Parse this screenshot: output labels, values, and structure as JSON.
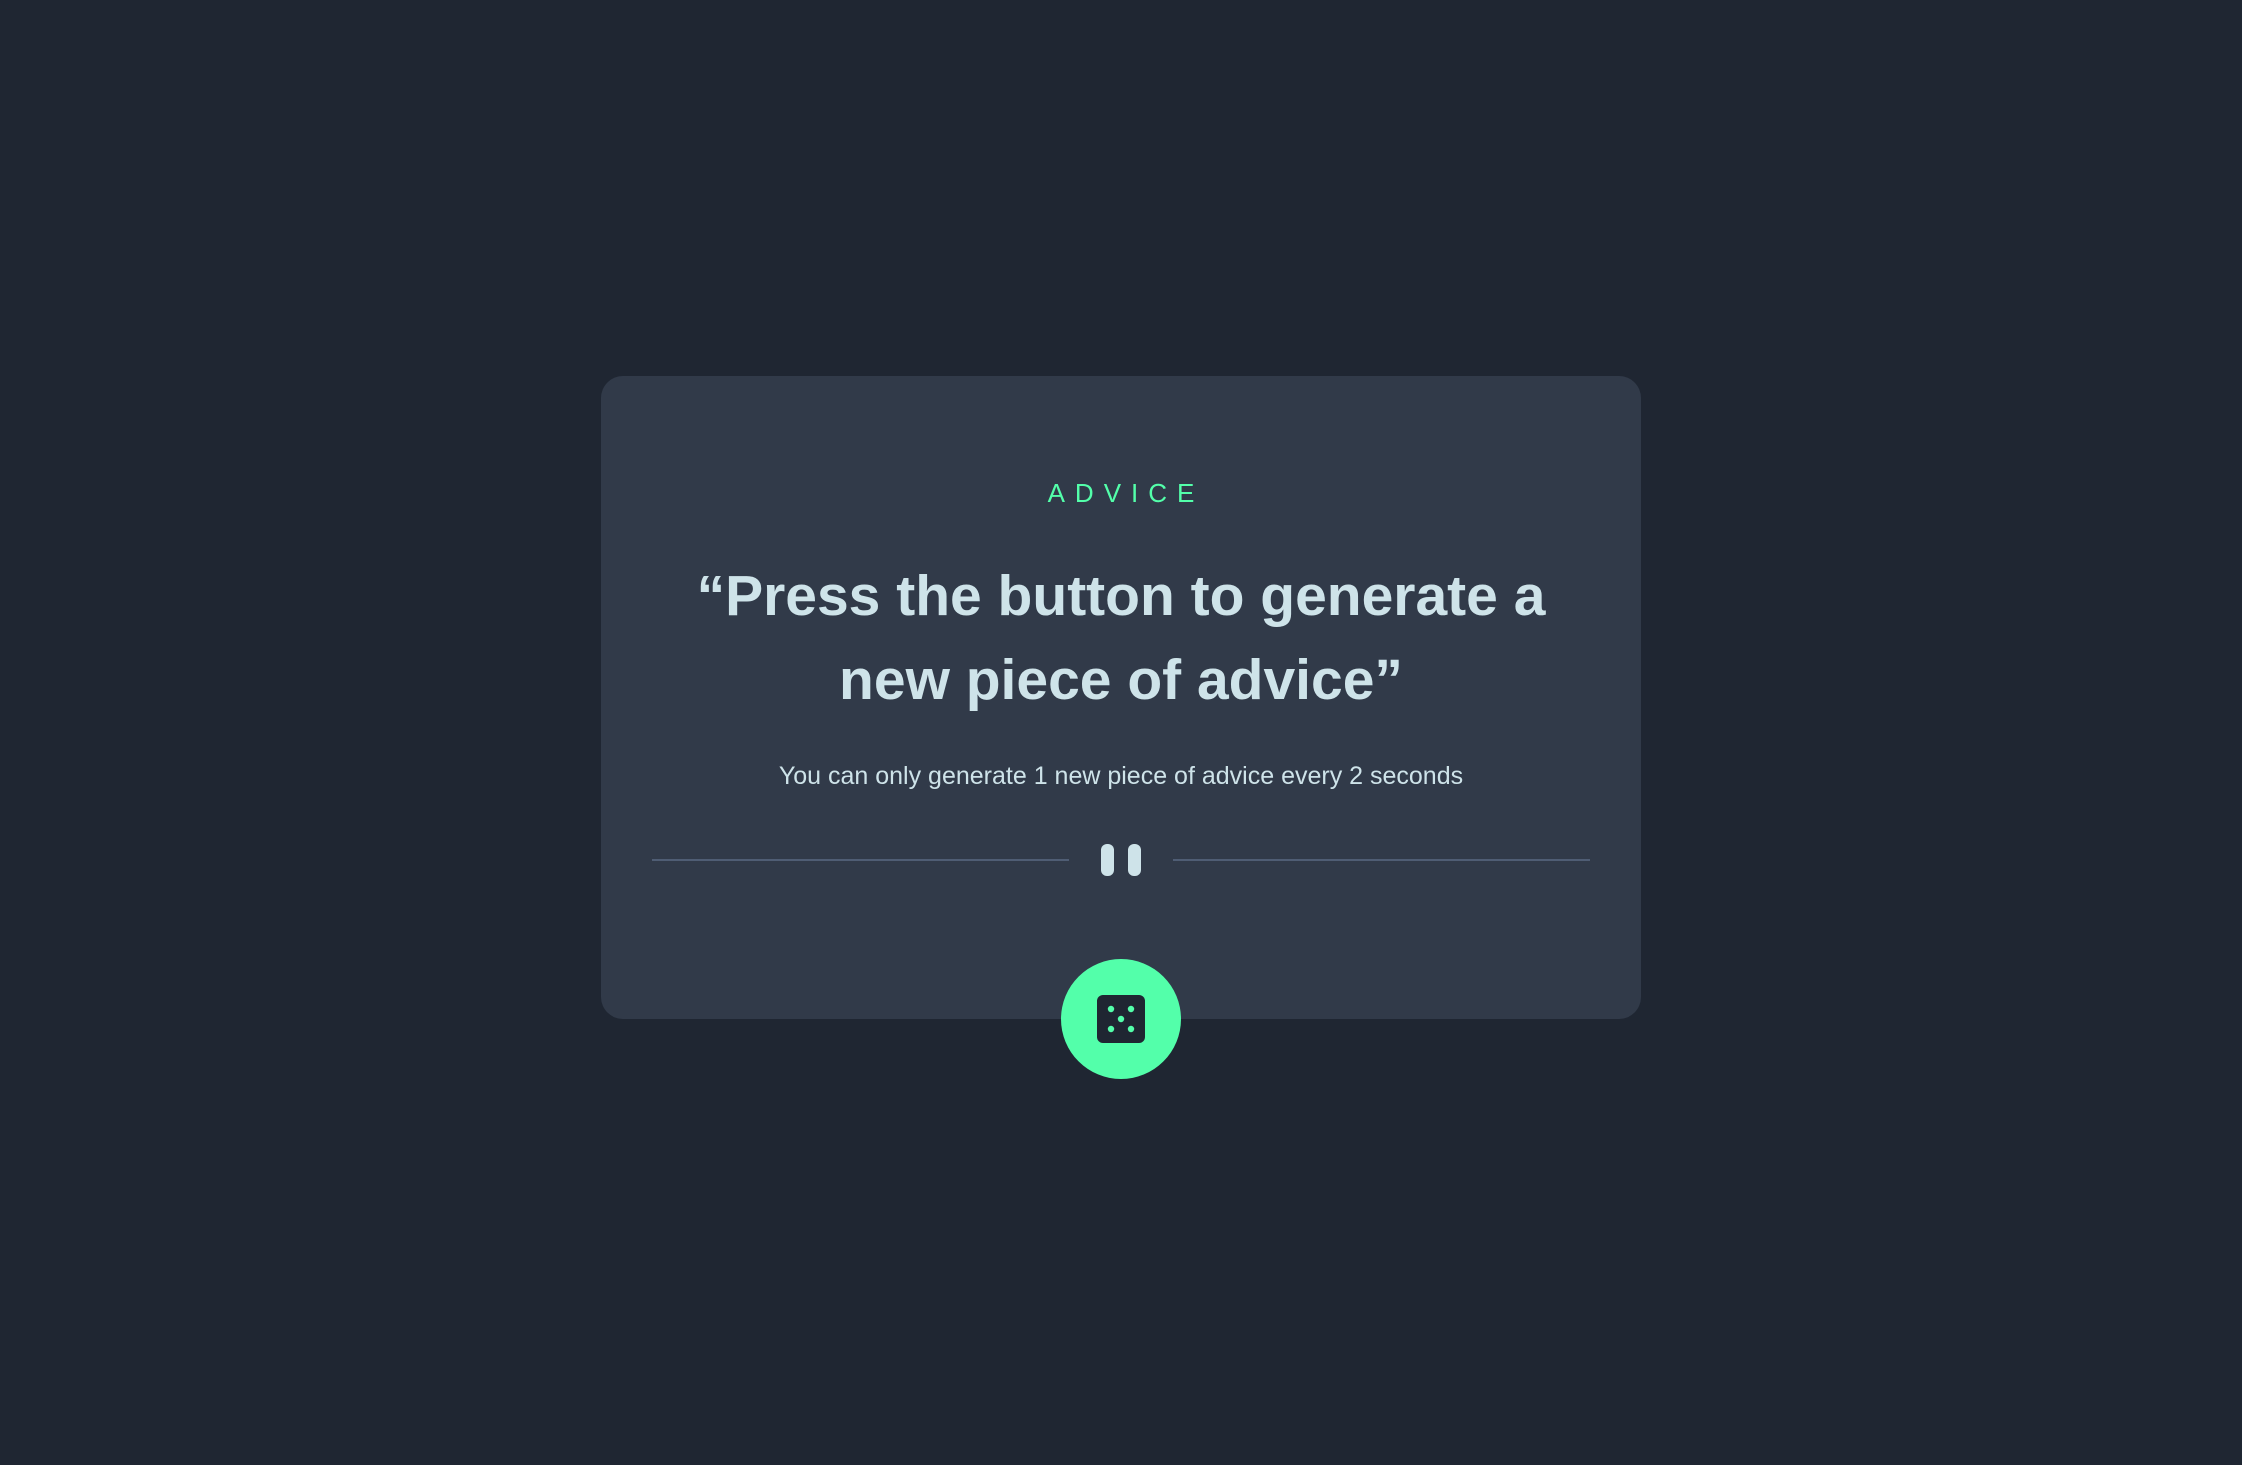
{
  "card": {
    "label": "ADVICE",
    "quote": "“Press the button to generate a new piece of advice”",
    "note": "You can only generate 1 new piece of advice every 2 seconds"
  },
  "divider": {
    "icon": "pause-icon"
  },
  "button": {
    "icon": "dice-icon"
  },
  "colors": {
    "background": "#1f2632",
    "card": "#313a49",
    "accent": "#53ffaa",
    "text": "#cee3e9",
    "divider": "#4f5d74"
  }
}
